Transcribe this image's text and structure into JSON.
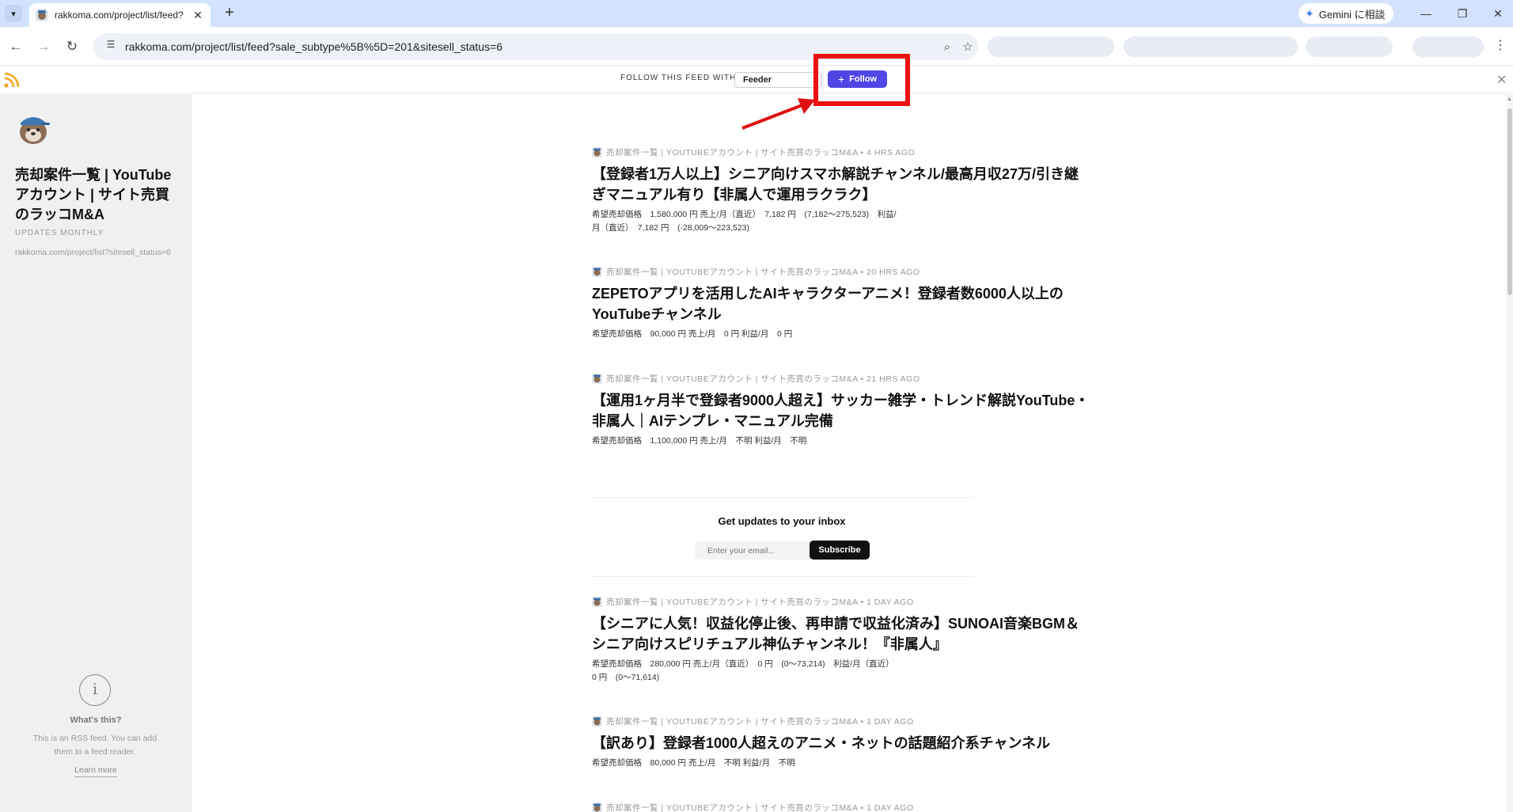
{
  "browser": {
    "tab_title": "rakkoma.com/project/list/feed?",
    "tab_close": "✕",
    "new_tab": "+",
    "url": "rakkoma.com/project/list/feed?sale_subtype%5B%5D=201&sitesell_status=6",
    "gemini_label": "Gemini に相談"
  },
  "followbar": {
    "label": "FOLLOW THIS FEED WITH",
    "reader_selected": "Feeder",
    "follow_label": "Follow"
  },
  "sidebar": {
    "title": "売却案件一覧 | YouTubeアカウント | サイト売買のラッコM&A",
    "frequency": "UPDATES MONTHLY",
    "url": "rakkoma.com/project/list?sitesell_status=6",
    "whats_this": "What's this?",
    "info_text": "This is an RSS feed. You can add them to a feed reader.",
    "learn_more": "Learn more"
  },
  "items": [
    {
      "meta": "売却案件一覧 | YOUTUBEアカウント | サイト売買のラッコM&A • 4 HRS AGO",
      "title": "【登録者1万人以上】シニア向けスマホ解説チャンネル/最高月収27万/引き継ぎマニュアル有り【非属人で運用ラクラク】",
      "desc": "希望売却価格　1,580,000 円 売上/月（直近）　7,182 円　(7,182～275,523)　利益/月（直近）　7,182 円　(-28,009～223,523)"
    },
    {
      "meta": "売却案件一覧 | YOUTUBEアカウント | サイト売買のラッコM&A • 20 HRS AGO",
      "title": "ZEPETOアプリを活用したAIキャラクターアニメ！登録者数6000人以上のYouTubeチャンネル",
      "desc": "希望売却価格　90,000 円 売上/月　0 円 利益/月　0 円"
    },
    {
      "meta": "売却案件一覧 | YOUTUBEアカウント | サイト売買のラッコM&A • 21 HRS AGO",
      "title": "【運用1ヶ月半で登録者9000人超え】サッカー雑学・トレンド解説YouTube・非属人｜AIテンプレ・マニュアル完備",
      "desc": "希望売却価格　1,100,000 円 売上/月　不明 利益/月　不明"
    },
    {
      "meta": "売却案件一覧 | YOUTUBEアカウント | サイト売買のラッコM&A • 1 DAY AGO",
      "title": "【シニアに人気！収益化停止後、再申請で収益化済み】SUNOAI音楽BGM＆シニア向けスピリチュアル神仏チャンネル！『非属人』",
      "desc": "希望売却価格　280,000 円 売上/月（直近）　0 円　(0～73,214)　利益/月（直近）　0 円　(0～71,614)"
    },
    {
      "meta": "売却案件一覧 | YOUTUBEアカウント | サイト売買のラッコM&A • 1 DAY AGO",
      "title": "【訳あり】登録者1000人超えのアニメ・ネットの話題紹介系チャンネル",
      "desc": "希望売却価格　80,000 円 売上/月　不明 利益/月　不明"
    },
    {
      "meta": "売却案件一覧 | YOUTUBEアカウント | サイト売買のラッコM&A • 1 DAY AGO",
      "title": "",
      "desc": ""
    }
  ],
  "subscribe": {
    "title": "Get updates to your inbox",
    "placeholder": "Enter your email...",
    "button": "Subscribe"
  },
  "colors": {
    "follow_button": "#4f46e5",
    "rss_orange": "#f4a623",
    "annotation_red": "#e11"
  }
}
